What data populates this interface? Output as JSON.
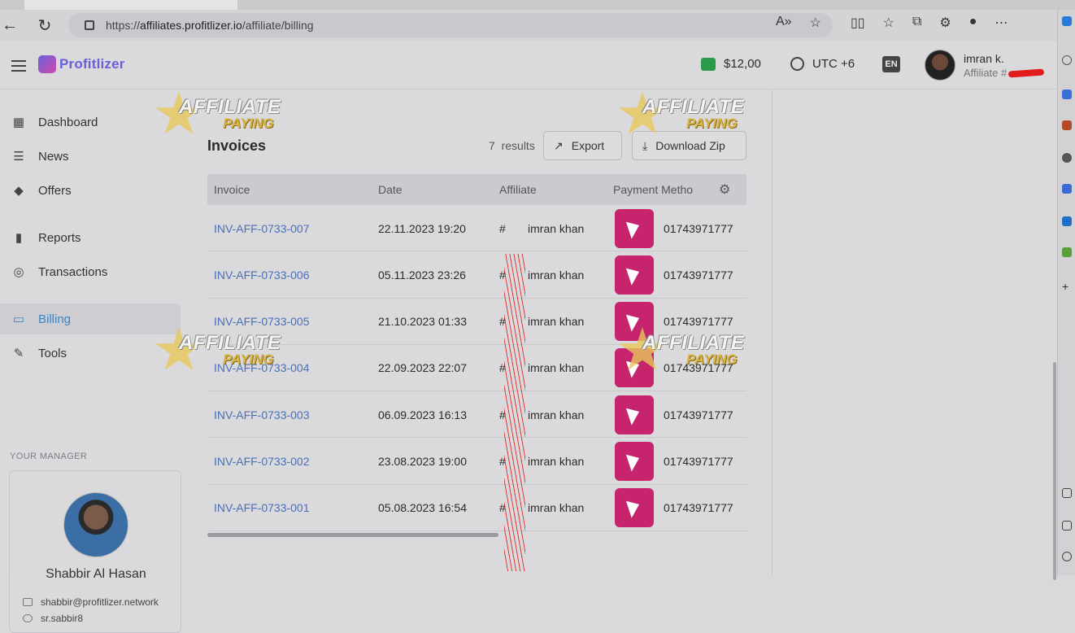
{
  "browser": {
    "url_prefix": "https://",
    "url_domain": "affiliates.profitlizer.io",
    "url_path": "/affiliate/billing"
  },
  "header": {
    "logo_text": "Profitlizer",
    "balance": "$12,00",
    "timezone": "UTC +6",
    "language": "EN",
    "user_name": "imran k.",
    "user_role": "Affiliate #"
  },
  "sidebar": {
    "items": [
      {
        "label": "Dashboard",
        "icon": "dashboard-icon"
      },
      {
        "label": "News",
        "icon": "news-icon"
      },
      {
        "label": "Offers",
        "icon": "tag-icon"
      },
      {
        "label": "Reports",
        "icon": "bar-chart-icon"
      },
      {
        "label": "Transactions",
        "icon": "fingerprint-icon"
      },
      {
        "label": "Billing",
        "icon": "card-icon"
      },
      {
        "label": "Tools",
        "icon": "wrench-icon"
      }
    ],
    "manager_label": "YOUR MANAGER",
    "manager": {
      "name": "Shabbir Al Hasan",
      "email": "shabbir@profitlizer.network",
      "skype": "sr.sabbir8"
    }
  },
  "main": {
    "title": "Invoices",
    "results_count": "7",
    "results_label": "results",
    "export_label": "Export",
    "download_label": "Download Zip",
    "columns": [
      "Invoice",
      "Date",
      "Affiliate",
      "Payment Metho"
    ],
    "rows": [
      {
        "invoice": "INV-AFF-0733-007",
        "date": "22.11.2023 19:20",
        "affiliate_prefix": "#",
        "affiliate": "imran khan",
        "account": "01743971777"
      },
      {
        "invoice": "INV-AFF-0733-006",
        "date": "05.11.2023 23:26",
        "affiliate_prefix": "#",
        "affiliate": "imran khan",
        "account": "01743971777"
      },
      {
        "invoice": "INV-AFF-0733-005",
        "date": "21.10.2023 01:33",
        "affiliate_prefix": "#",
        "affiliate": "imran khan",
        "account": "01743971777"
      },
      {
        "invoice": "INV-AFF-0733-004",
        "date": "22.09.2023 22:07",
        "affiliate_prefix": "#",
        "affiliate": "imran khan",
        "account": "01743971777"
      },
      {
        "invoice": "INV-AFF-0733-003",
        "date": "06.09.2023 16:13",
        "affiliate_prefix": "#",
        "affiliate": "imran khan",
        "account": "01743971777"
      },
      {
        "invoice": "INV-AFF-0733-002",
        "date": "23.08.2023 19:00",
        "affiliate_prefix": "#",
        "affiliate": "imran khan",
        "account": "01743971777"
      },
      {
        "invoice": "INV-AFF-0733-001",
        "date": "05.08.2023 16:54",
        "affiliate_prefix": "#",
        "affiliate": "imran khan",
        "account": "01743971777"
      }
    ]
  },
  "watermark": {
    "line1": "AFFILIATE",
    "line2": "PAYING"
  },
  "colors": {
    "link": "#4a6fb5",
    "active": "#3a86c4",
    "bkash": "#c6246d",
    "wallet": "#2b9a4a"
  }
}
